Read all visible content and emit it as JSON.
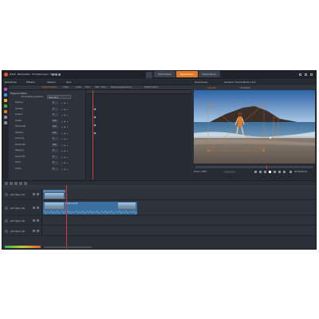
{
  "app": {
    "menu_items": [
      "Datei",
      "Bearbeiten",
      "Einstellungen",
      "Hilfe"
    ],
    "tabs": [
      {
        "label": "Importieren",
        "active": false
      },
      {
        "label": "Bearbeiten",
        "active": true
      },
      {
        "label": "Exportieren",
        "active": false
      }
    ],
    "accent_color": "#e27a26",
    "playhead_color": "#d33c3c"
  },
  "library_toolbar": {
    "items": [
      "Bibliothek",
      "Effekte",
      "Medien",
      "Text"
    ]
  },
  "effect_tabs": [
    {
      "label": "Eigenschaften",
      "active": true
    },
    {
      "label": "Video",
      "active": false
    },
    {
      "label": "Audio",
      "active": false
    },
    {
      "label": "Titel",
      "active": false
    },
    {
      "label": "360° Video",
      "active": false
    },
    {
      "label": "Bewegungstracking",
      "active": false
    },
    {
      "label": "Farbkorrektur",
      "active": false
    }
  ],
  "properties": {
    "header": "Eigenschaften",
    "preset_label": "Voreinstellung wählen",
    "preset_value": "Standard",
    "rows": [
      {
        "label": "Position",
        "value": "0"
      },
      {
        "label": "Vertikal",
        "value": "0"
      },
      {
        "label": "Drehen",
        "value": "0"
      },
      {
        "label": "Größe",
        "value": "100"
      },
      {
        "label": "Horizontal",
        "value": "100"
      },
      {
        "label": "Vertikal",
        "value": "100"
      },
      {
        "label": "Drehung",
        "value": "0"
      },
      {
        "label": "Deckkraft",
        "value": "100"
      },
      {
        "label": "Neigung",
        "value": "0"
      },
      {
        "label": "Zuschnitt",
        "value": "0"
      },
      {
        "label": "Oben",
        "value": "0"
      },
      {
        "label": "Unten",
        "value": "0"
      }
    ]
  },
  "preview": {
    "header_left": "Zuschauen",
    "header_right": "Kamera: Hd-Sd-Mode 16:9",
    "tabs": [
      {
        "label": "Quelle",
        "active": true
      },
      {
        "label": "Timeline",
        "active": false
      }
    ],
    "timecode": "00:00:09.24",
    "zoom_label": "Zoom: 100%"
  },
  "timeline": {
    "tracks": [
      {
        "name": "A/V Spur (1)",
        "has_clip": true
      },
      {
        "name": "A/V Spur (2)",
        "has_clip": true
      },
      {
        "name": "A/V Spur (3)",
        "has_clip": false
      },
      {
        "name": "A/V Spur (4)",
        "has_clip": false
      }
    ],
    "clip_label": "Strand.mp4"
  }
}
